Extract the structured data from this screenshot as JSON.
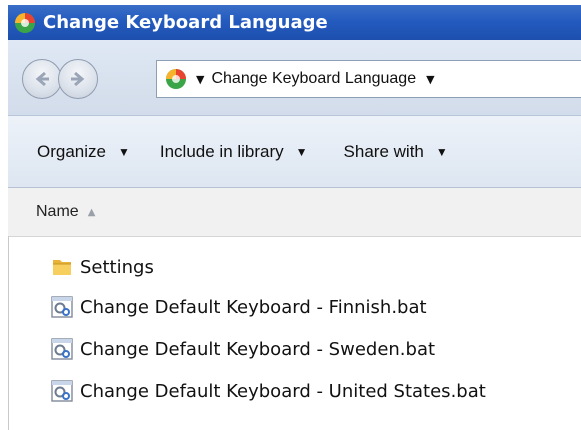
{
  "window": {
    "title": "Change Keyboard Language"
  },
  "address_bar": {
    "crumb": "Change Keyboard Language"
  },
  "toolbar": {
    "organize": "Organize",
    "include_in_library": "Include in library",
    "share_with": "Share with"
  },
  "columns": {
    "name": "Name"
  },
  "files": [
    {
      "name": "Settings",
      "icon": "folder-icon"
    },
    {
      "name": "Change Default Keyboard - Finnish.bat",
      "icon": "batch-file-icon"
    },
    {
      "name": "Change Default Keyboard - Sweden.bat",
      "icon": "batch-file-icon"
    },
    {
      "name": "Change Default Keyboard - United States.bat",
      "icon": "batch-file-icon"
    }
  ],
  "colors": {
    "titlebar": "#245bbf",
    "toolbar": "#dde6f1"
  }
}
